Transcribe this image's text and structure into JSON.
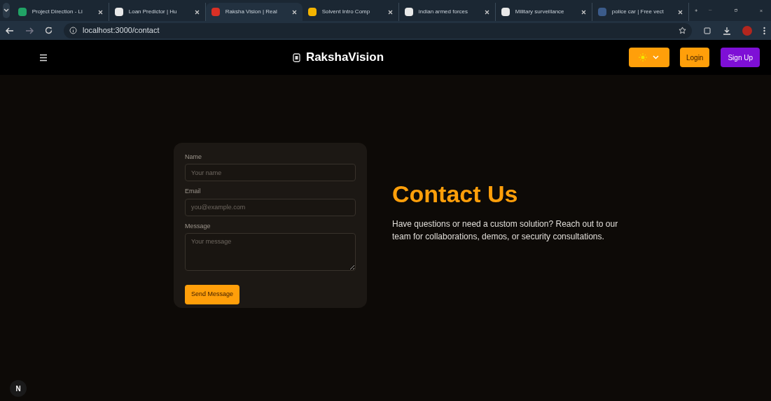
{
  "browser": {
    "tabs": [
      {
        "title": "Project Direction - Li",
        "selected": false,
        "color": "#21a366"
      },
      {
        "title": "Loan Predictor | Hu",
        "selected": false,
        "color": "#e8e8e8"
      },
      {
        "title": "Raksha Vision | Real",
        "selected": true,
        "color": "#d93025"
      },
      {
        "title": "Solvent Intro Comp",
        "selected": false,
        "color": "#f4b400"
      },
      {
        "title": "indian armed forces",
        "selected": false,
        "color": "#e8e8e8"
      },
      {
        "title": "Military surveillance",
        "selected": false,
        "color": "#e8e8e8"
      },
      {
        "title": "police car | Free vect",
        "selected": false,
        "color": "#3b5b8a"
      }
    ],
    "url": "localhost:3000/contact"
  },
  "navbar": {
    "brand": "RakshaVision",
    "login": "Login",
    "signup": "Sign Up"
  },
  "form": {
    "fields": [
      {
        "label": "Name",
        "placeholder": "Your name",
        "kind": "input"
      },
      {
        "label": "Email",
        "placeholder": "you@example.com",
        "kind": "input"
      },
      {
        "label": "Message",
        "placeholder": "Your message",
        "kind": "textarea"
      }
    ],
    "submit": "Send Message"
  },
  "intro": {
    "heading": "Contact Us",
    "text": "Have questions or need a custom solution? Reach out to our team for collaborations, demos, or security consultations."
  },
  "dev_badge": "N"
}
